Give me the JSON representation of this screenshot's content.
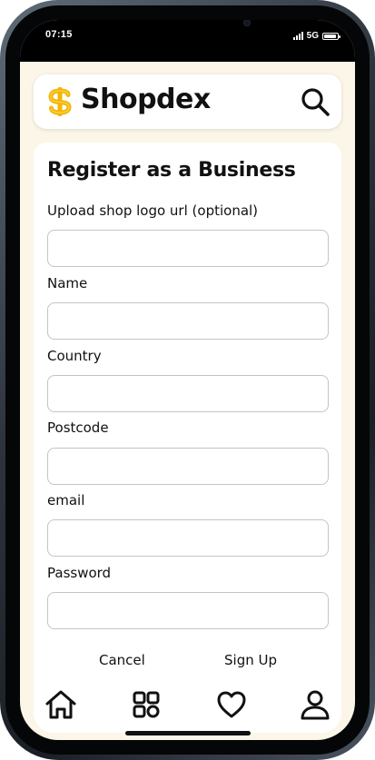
{
  "status_bar": {
    "time": "07:15",
    "network": "5G",
    "icons": [
      "signal-icon",
      "battery-icon"
    ]
  },
  "header": {
    "brand": "Shopdex",
    "logo_icon": "dollar-sign-icon",
    "search_icon": "search-icon",
    "accent_color": "#f4b400"
  },
  "form": {
    "title": "Register as a Business",
    "fields": [
      {
        "label": "Upload shop logo url (optional)",
        "value": "",
        "placeholder": ""
      },
      {
        "label": "Name",
        "value": "",
        "placeholder": ""
      },
      {
        "label": "Country",
        "value": "",
        "placeholder": ""
      },
      {
        "label": "Postcode",
        "value": "",
        "placeholder": ""
      },
      {
        "label": "email",
        "value": "",
        "placeholder": ""
      },
      {
        "label": "Password",
        "value": "",
        "placeholder": ""
      }
    ],
    "cancel_label": "Cancel",
    "signup_label": "Sign Up"
  },
  "bottom_nav": {
    "items": [
      {
        "icon": "home-icon"
      },
      {
        "icon": "grid-icon"
      },
      {
        "icon": "heart-icon"
      },
      {
        "icon": "user-icon"
      }
    ]
  },
  "colors": {
    "background": "#fbf6e8",
    "card": "#ffffff",
    "text": "#111111",
    "input_border": "#c4c4c4"
  }
}
